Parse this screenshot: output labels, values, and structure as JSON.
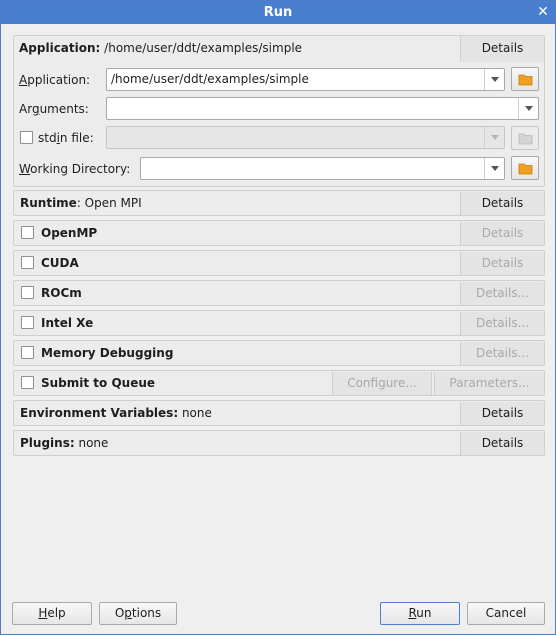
{
  "window": {
    "title": "Run"
  },
  "application_group": {
    "header_label": "Application:",
    "header_value": "/home/user/ddt/examples/simple",
    "details": "Details",
    "application_label": "Application:",
    "application_value": "/home/user/ddt/examples/simple",
    "arguments_label": "Arguments:",
    "arguments_value": "",
    "stdin_label": "stdin file:",
    "stdin_value": "",
    "workdir_label": "Working Directory:",
    "workdir_value": ""
  },
  "runtime": {
    "label": "Runtime",
    "value": ": Open MPI",
    "details": "Details"
  },
  "options": [
    {
      "label": "OpenMP",
      "details": "Details"
    },
    {
      "label": "CUDA",
      "details": "Details"
    },
    {
      "label": "ROCm",
      "details": "Details..."
    },
    {
      "label": "Intel Xe",
      "details": "Details..."
    },
    {
      "label": "Memory Debugging",
      "details": "Details..."
    }
  ],
  "queue": {
    "label": "Submit to Queue",
    "configure": "Configure...",
    "parameters": "Parameters..."
  },
  "environment": {
    "label": "Environment Variables:",
    "value": "none",
    "details": "Details"
  },
  "plugins": {
    "label": "Plugins:",
    "value": "none",
    "details": "Details"
  },
  "footer": {
    "help": "Help",
    "options": "Options",
    "run": "Run",
    "cancel": "Cancel"
  },
  "colors": {
    "titlebar": "#4a7fd0",
    "folder": "#f0a020"
  }
}
